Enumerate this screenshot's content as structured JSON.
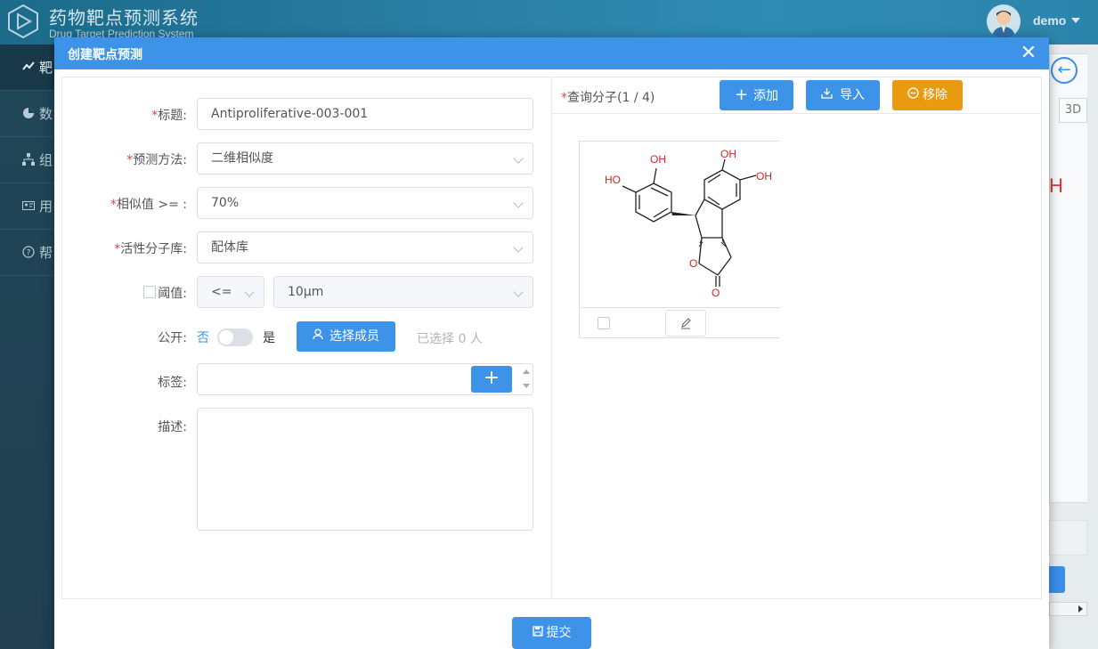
{
  "app": {
    "title": "药物靶点预测系统",
    "subtitle": "Drug Target Prediction System",
    "user": "demo"
  },
  "sidebar": {
    "items": [
      {
        "label": "靶",
        "icon": "trend-icon"
      },
      {
        "label": "数",
        "icon": "pie-chart-icon"
      },
      {
        "label": "组",
        "icon": "org-icon"
      },
      {
        "label": "用",
        "icon": "user-card-icon"
      },
      {
        "label": "帮",
        "icon": "help-icon"
      }
    ]
  },
  "background_panel": {
    "view_3d": "3D",
    "fragment_text": "H"
  },
  "dialog": {
    "title": "创建靶点预测",
    "close_label": "✕",
    "form": {
      "title_label": "标题:",
      "title_value": "Antiproliferative-003-001",
      "method_label": "预测方法:",
      "method_value": "二维相似度",
      "similarity_label": "相似值 >= :",
      "similarity_value": "70%",
      "library_label": "活性分子库:",
      "library_value": "配体库",
      "threshold_label": "阈值:",
      "threshold_operator": "<=",
      "threshold_value": "10μm",
      "public_label": "公开:",
      "public_no": "否",
      "public_yes": "是",
      "public_on": false,
      "select_members_label": "选择成员",
      "selected_count_text": "已选择 0 人",
      "tags_label": "标签:",
      "tags_add_label": "+",
      "description_label": "描述:"
    },
    "query": {
      "label": "查询分子(1 / 4)",
      "add_label": "添加",
      "import_label": "导入",
      "remove_label": "移除"
    },
    "molecule": {
      "atoms": {
        "oh1": "OH",
        "ho": "HO",
        "oh2": "OH",
        "oh3": "OH",
        "o_ring": "O",
        "o_carbonyl": "O"
      }
    },
    "submit_label": "提交"
  },
  "colors": {
    "primary": "#3d93e8",
    "warning": "#e89a10",
    "required": "#e0453f",
    "oxygen": "#e02020"
  }
}
